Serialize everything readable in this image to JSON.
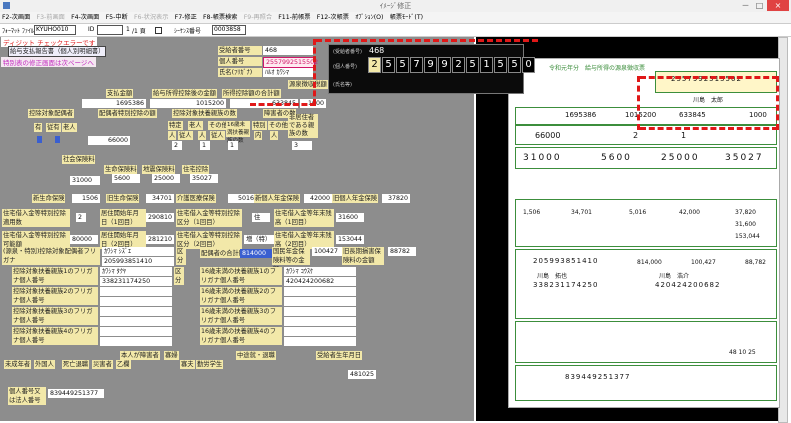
{
  "window": {
    "title": "ｲﾒｰｼﾞ修正",
    "min_glyph": "－",
    "max_glyph": "□",
    "close_glyph": "×"
  },
  "menu": [
    {
      "label": "F2-次画面",
      "enabled": true
    },
    {
      "label": "F3-前画面",
      "enabled": false
    },
    {
      "label": "F4-次画面",
      "enabled": true
    },
    {
      "label": "F5-中断",
      "enabled": true
    },
    {
      "label": "F6-状況表示",
      "enabled": false
    },
    {
      "label": "F7-修正",
      "enabled": true
    },
    {
      "label": "F8-帳票検索",
      "enabled": true
    },
    {
      "label": "F9-再照合",
      "enabled": false
    },
    {
      "label": "F11-前帳票",
      "enabled": true
    },
    {
      "label": "F12-次帳票",
      "enabled": true
    },
    {
      "label": "ｵﾌﾟｼｮﾝ(O)",
      "enabled": true
    },
    {
      "label": "帳票ﾓｰﾄﾞ(T)",
      "enabled": true
    }
  ],
  "toolbar": {
    "format_label": "ﾌｫｰﾏｯﾄ ﾌｧｲﾙ",
    "format_value": "KYUHO010",
    "id_label": "ID",
    "page_value": "1",
    "page_suffix": "/1 頁",
    "seq_label": "ｼｰｹﾝｽ番号",
    "seq_value": "0003858"
  },
  "messages": {
    "error": "ディジット チェックエラーです",
    "title": "給与支払報告書（個人別明細書）",
    "note": "特別表の修正画面は次ページへ"
  },
  "header": {
    "receipt_label": "受給者番号",
    "receipt_value": "468",
    "personal_label": "個人番号",
    "personal_value": "2557992515502",
    "name_label": "氏名(ﾌﾘｶﾞﾅ)",
    "name_value": "ﾊﾙｵ ｶﾜｼﾏ"
  },
  "popup": {
    "row1_label": "(受給者番号)",
    "row1_value": "468",
    "row2_label": "(個人番号)",
    "digits": [
      "2",
      "5",
      "5",
      "7",
      "9",
      "9",
      "2",
      "5",
      "1",
      "5",
      "5",
      "0",
      "2"
    ],
    "row3_label": "(氏名等)"
  },
  "income": {
    "headers": [
      "支払金額",
      "給与所得控除後の金額",
      "所得控除額の合計額",
      "源泉徴収税額"
    ],
    "values": [
      "1695386",
      "1015200",
      "633845",
      "1000"
    ]
  },
  "dependents": {
    "header1": "控除対象配偶者",
    "header2": "配偶者特別控除の額",
    "header3": "控除対象扶養親族の数",
    "header4": "障害者の数",
    "sub": [
      "有",
      "従有",
      "老人",
      "特定",
      "老人",
      "その他",
      "16歳未満扶養親族の数",
      "特別",
      "その他",
      "非居住者である親族の数"
    ],
    "sub2": [
      "人",
      "従人",
      "内",
      "人",
      "従人",
      "人",
      "従人",
      "人",
      "内",
      "人"
    ],
    "spouse_amount": "66000",
    "children16": "1",
    "row_val1": "2",
    "row_val2": "1",
    "nonres": "3"
  },
  "insurance": {
    "labels": [
      "社会保険料",
      "生命保険料",
      "地震保険料",
      "住宅控除"
    ],
    "values": [
      "31000",
      "5600",
      "25000",
      "35027"
    ]
  },
  "life": {
    "labels": [
      "新生命保険",
      "旧生命保険",
      "介護医療保険",
      "新個人年金保険",
      "旧個人年金保険"
    ],
    "values": [
      "1506",
      "34701",
      "5016",
      "42000",
      "37820"
    ]
  },
  "housing": {
    "r1_label": "住宅借入金等特別控除適用数",
    "r1_val": "2",
    "r1b_label": "居住開始年月日（1回目）",
    "r1b_val": "290810",
    "r1c_label": "住宅借入金等特別控除区分（1回目）",
    "r1c_val": "住",
    "r1d_label": "住宅借入金等年末残高（1回目）",
    "r1d_val": "31600",
    "r2_label": "住宅借入金等特別控除可能額",
    "r2_val": "80000",
    "r2b_label": "居住開始年月日（2回目）",
    "r2b_val": "281210",
    "r2c_label": "住宅借入金等特別控除区分（2回目）",
    "r2c_val": "増（特）",
    "r2d_label": "住宅借入金等年末残高（2回目）",
    "r2d_val": "153044"
  },
  "spouse": {
    "furigana_label": "(源泉・特別)控除対象配偶者フリガナ",
    "furigana_val": "ｶﾜｼﾏ ｼｽﾞｴ",
    "num_label": "個人番号",
    "num_val": "205993851410",
    "kubun_label": "区分",
    "income_label": "配偶者の合計所得",
    "income_val": "814000",
    "nenkin_label": "国民年金保険料等の金額",
    "nenkin_val": "100427",
    "kyu_label": "旧長期損害保険料の金額",
    "kyu_val": "88782"
  },
  "fuyou1": {
    "label": "控除対象扶養親族1のフリガナ個人番号",
    "furigana": "ｶﾜｼﾏ ﾀｸﾔ",
    "num": "338231174250",
    "kubun": "区分"
  },
  "fuyou16_1": {
    "label": "16歳未満の扶養親族1のフリガナ個人番号",
    "furigana": "ｶﾜｼﾏ ｺｳｽｹ",
    "num": "420424200682"
  },
  "fuyou2": {
    "label": "控除対象扶養親族2のフリガナ個人番号"
  },
  "fuyou16_2": {
    "label": "16歳未満の扶養親族2のフリガナ個人番号"
  },
  "fuyou3": {
    "label": "控除対象扶養親族3のフリガナ個人番号"
  },
  "fuyou16_3": {
    "label": "16歳未満の扶養親族3のフリガナ個人番号"
  },
  "fuyou4": {
    "label": "控除対象扶養親族4のフリガナ個人番号"
  },
  "fuyou16_4": {
    "label": "16歳未満の扶養親族4のフリガナ個人番号"
  },
  "bottom": {
    "cols": [
      "未成年者",
      "外国人",
      "死亡退職",
      "災害者",
      "乙欄",
      "本人が障害者",
      "寡婦",
      "寡夫",
      "勤労学生",
      "中途就・退職",
      "受給者生年月日"
    ],
    "sub": [
      "特別",
      "その他",
      "一般",
      "特別",
      "就職",
      "退職",
      "年",
      "月",
      "日",
      "明",
      "大",
      "昭",
      "平",
      "年",
      "月",
      "日"
    ],
    "birth": "481025"
  },
  "payer": {
    "label": "個人番号又は法人番号",
    "value": "839449251377"
  },
  "doc": {
    "title_row": "令和元年分　給与所得の源泉徴収票",
    "amounts": [
      "1695386",
      "1015200",
      "633845",
      "1000"
    ],
    "row2": [
      "66000",
      "2",
      "1"
    ],
    "row3": [
      "31000",
      "5600",
      "25000",
      "35027"
    ],
    "block": [
      "1,506",
      "34,701",
      "5,016",
      "42,000",
      "37,820"
    ],
    "small_vals": [
      "31,600",
      "153,044"
    ],
    "spouse_digits": "205993851410",
    "spouse_income": "814,000",
    "nenkin": "100,427",
    "kyu": "88,782",
    "dep1": "338231174250",
    "dep16_1": "420424200682",
    "name": "川島　太郎",
    "dep_name": "川島　拓也",
    "dep16_name": "川島　浩介",
    "payer_digits": "839449251377",
    "header_digits": "2557992515502",
    "birth": "48 10 25"
  }
}
